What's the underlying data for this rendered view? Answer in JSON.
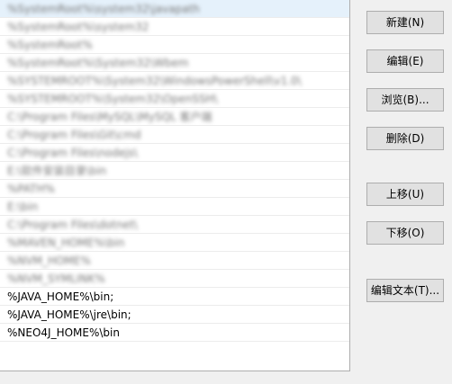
{
  "rows": [
    {
      "text": "%SystemRoot%\\system32\\javapath",
      "obscured": true
    },
    {
      "text": "%SystemRoot%\\system32",
      "obscured": true
    },
    {
      "text": "%SystemRoot%",
      "obscured": true
    },
    {
      "text": "%SystemRoot%\\System32\\Wbem",
      "obscured": true
    },
    {
      "text": "%SYSTEMROOT%\\System32\\WindowsPowerShell\\v1.0\\",
      "obscured": true
    },
    {
      "text": "%SYSTEMROOT%\\System32\\OpenSSH\\",
      "obscured": true
    },
    {
      "text": "C:\\Program Files\\MySQL\\MySQL 客户端",
      "obscured": true
    },
    {
      "text": "C:\\Program Files\\Git\\cmd",
      "obscured": true
    },
    {
      "text": "C:\\Program Files\\nodejs\\",
      "obscured": true
    },
    {
      "text": "E:\\软件安装目录\\bin",
      "obscured": true
    },
    {
      "text": "%PATH%",
      "obscured": true
    },
    {
      "text": "E:\\bin",
      "obscured": true
    },
    {
      "text": "C:\\Program Files\\dotnet\\",
      "obscured": true
    },
    {
      "text": "%MAVEN_HOME%\\bin",
      "obscured": true
    },
    {
      "text": "%NVM_HOME%",
      "obscured": true
    },
    {
      "text": "%NVM_SYMLINK%",
      "obscured": true
    },
    {
      "text": "%JAVA_HOME%\\bin;",
      "obscured": false
    },
    {
      "text": "%JAVA_HOME%\\jre\\bin;",
      "obscured": false
    },
    {
      "text": "%NEO4J_HOME%\\bin",
      "obscured": false
    }
  ],
  "buttons": {
    "new": "新建(N)",
    "edit": "编辑(E)",
    "browse": "浏览(B)...",
    "delete": "删除(D)",
    "move_up": "上移(U)",
    "move_down": "下移(O)",
    "edit_text": "编辑文本(T)..."
  }
}
